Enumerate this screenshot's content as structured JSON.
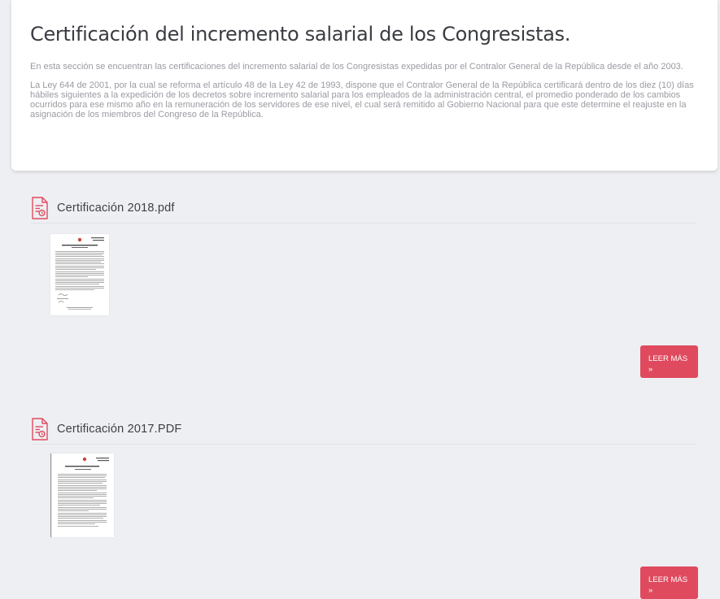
{
  "page": {
    "title": "Certificación del incremento salarial de los Congresistas.",
    "intro_paragraphs": [
      "En esta sección se encuentran las certificaciones del incremento salarial de los Congresistas expedidas por el Contralor General de la República desde el año 2003.",
      "La Ley 644 de 2001, por la cual se reforma el artículo 48 de la Ley 42 de 1993, dispone que el Contralor General de la República certificará dentro de los diez (10) días hábiles siguientes a la expedición de los decretos sobre incremento salarial para los empleados de la administración central, el promedio ponderado de los cambios ocurridos para ese mismo año en la remuneración de los servidores de ese nivel, el cual será remitido al Gobierno Nacional para que este determine el reajuste en la asignación de los miembros del Congreso de la República."
    ]
  },
  "documents": [
    {
      "title": "Certificación 2018.pdf",
      "icon": "pdf-file-icon",
      "button": {
        "label": "LEER MÁS",
        "arrow": "»"
      }
    },
    {
      "title": "Certificación 2017.PDF",
      "icon": "pdf-file-icon",
      "button": {
        "label": "LEER MÁS",
        "arrow": "»"
      }
    }
  ],
  "colors": {
    "accent": "#df4a5e",
    "background": "#eeeff3",
    "card": "#ffffff",
    "title_text": "#3a3c42",
    "body_text": "#9a9ba2"
  }
}
